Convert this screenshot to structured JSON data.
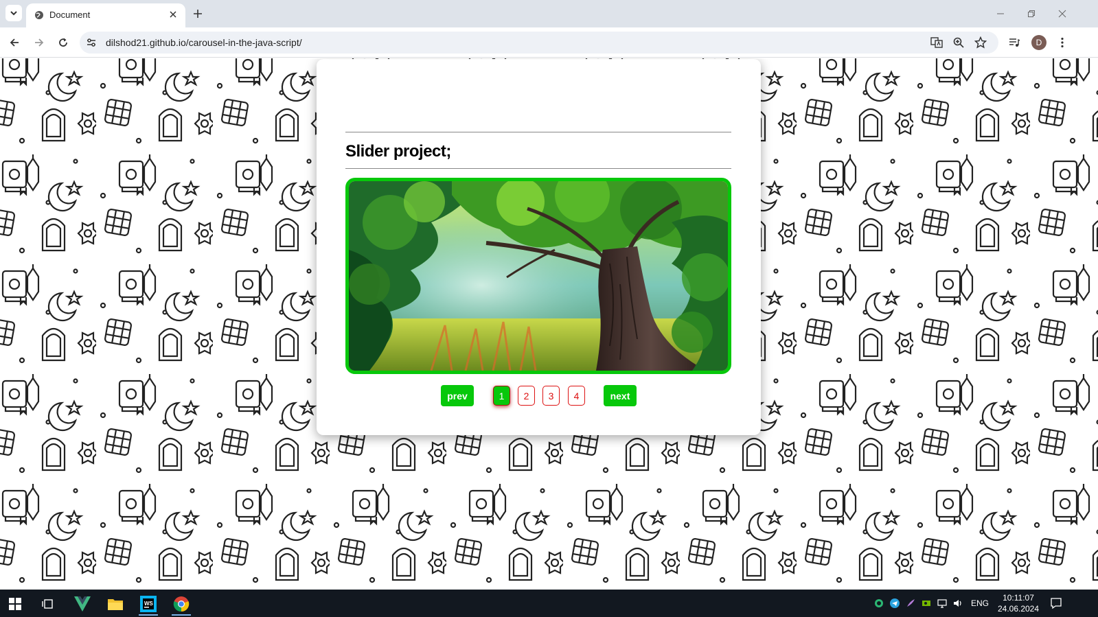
{
  "browser": {
    "tab_title": "Document",
    "url": "dilshod21.github.io/carousel-in-the-java-script/",
    "profile_initial": "D"
  },
  "page": {
    "title": "Slider project;",
    "slider": {
      "current_slide": 1,
      "total_slides": 4,
      "prev_label": "prev",
      "next_label": "next",
      "dots": [
        "1",
        "2",
        "3",
        "4"
      ]
    },
    "colors": {
      "accent_green": "#07c80b",
      "dot_red": "#dd1111"
    }
  },
  "taskbar": {
    "language": "ENG",
    "time": "10:11:07",
    "date": "24.06.2024"
  }
}
